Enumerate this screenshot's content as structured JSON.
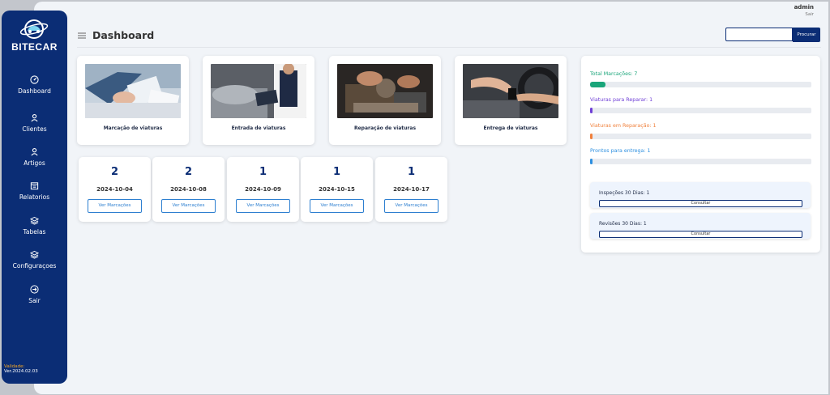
{
  "brand": {
    "name": "BITECAR"
  },
  "user": {
    "name": "admin",
    "logout": "Sair"
  },
  "header": {
    "title": "Dashboard",
    "search_placeholder": "",
    "search_button": "Procurar"
  },
  "sidebar": {
    "items": [
      {
        "label": "Dashboard",
        "icon": "gauge-icon"
      },
      {
        "label": "Clientes",
        "icon": "user-icon"
      },
      {
        "label": "Artigos",
        "icon": "user-icon"
      },
      {
        "label": "Relatorios",
        "icon": "calendar-icon"
      },
      {
        "label": "Tabelas",
        "icon": "layers-icon"
      },
      {
        "label": "Configuraçoes",
        "icon": "layers-icon"
      },
      {
        "label": "Sair",
        "icon": "exit-icon"
      }
    ],
    "validity_label": "Validade:",
    "version": "Ver.2024.02.03"
  },
  "services": [
    {
      "label": "Marcação de viaturas"
    },
    {
      "label": "Entrada de viaturas"
    },
    {
      "label": "Reparação de viaturas"
    },
    {
      "label": "Entrega de viaturas"
    }
  ],
  "dates": [
    {
      "count": "2",
      "date": "2024-10-04",
      "button": "Ver Marcações"
    },
    {
      "count": "2",
      "date": "2024-10-08",
      "button": "Ver Marcações"
    },
    {
      "count": "1",
      "date": "2024-10-09",
      "button": "Ver Marcações"
    },
    {
      "count": "1",
      "date": "2024-10-15",
      "button": "Ver Marcações"
    },
    {
      "count": "1",
      "date": "2024-10-17",
      "button": "Ver Marcações"
    }
  ],
  "stats": [
    {
      "label": "Total Marcações: 7",
      "color": "#1aa57a",
      "fraction": 0.07
    },
    {
      "label": "Viaturas para Reparar: 1",
      "color": "#6f3fd6",
      "fraction": 0.01
    },
    {
      "label": "Viaturas em Reparação: 1",
      "color": "#f0803c",
      "fraction": 0.01
    },
    {
      "label": "Prontos para entrega: 1",
      "color": "#2d8fe0",
      "fraction": 0.01
    }
  ],
  "inspections": {
    "label": "Inspeções 30 Dias: 1",
    "button": "Consultar"
  },
  "revisions": {
    "label": "Revisões 30 Dias: 1",
    "button": "Consultar"
  }
}
